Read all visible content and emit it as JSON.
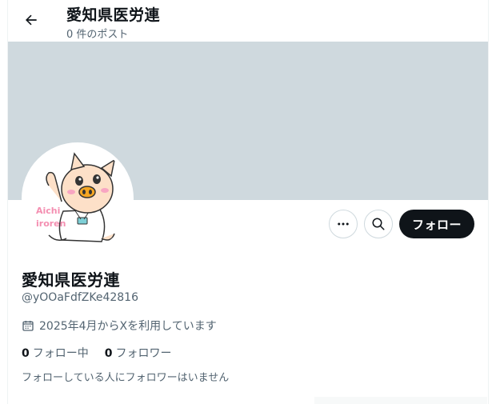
{
  "header": {
    "back_icon": "arrow-left-icon",
    "title": "愛知県医労連",
    "post_count": "0 件のポスト"
  },
  "profile": {
    "banner_color": "#cfd9de",
    "avatar_text_line1": "Aichi",
    "avatar_text_line2": "iroren",
    "name": "愛知県医労連",
    "handle": "@yOOaFdfZKe42816",
    "joined": "2025年4月からXを利用しています",
    "following_count": "0",
    "following_label": "フォロー中",
    "followers_count": "0",
    "followers_label": "フォロワー",
    "followers_note": "フォローしている人にフォロワーはいません"
  },
  "actions": {
    "more_icon": "more-icon",
    "search_icon": "search-icon",
    "follow_label": "フォロー"
  },
  "colors": {
    "text": "#0f1419",
    "secondary": "#536471",
    "follow_bg": "#0f1419"
  }
}
